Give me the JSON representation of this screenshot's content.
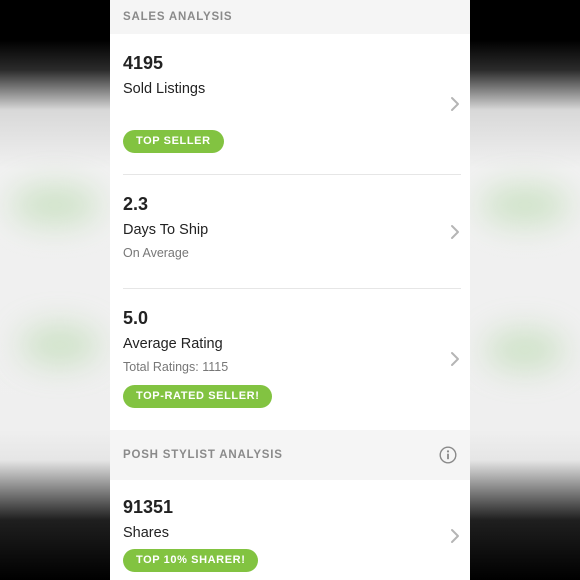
{
  "sales_section": {
    "title": "SALES ANALYSIS",
    "items": [
      {
        "value": "4195",
        "label": "Sold Listings",
        "sub": "",
        "badge": "TOP SELLER"
      },
      {
        "value": "2.3",
        "label": "Days To Ship",
        "sub": "On Average",
        "badge": ""
      },
      {
        "value": "5.0",
        "label": "Average Rating",
        "sub": "Total Ratings: 1115",
        "badge": "TOP-RATED SELLER!"
      }
    ]
  },
  "stylist_section": {
    "title": "POSH STYLIST ANALYSIS",
    "info_icon": "info-icon",
    "items": [
      {
        "value": "91351",
        "label": "Shares",
        "badge": "TOP 10% SHARER!"
      }
    ]
  },
  "colors": {
    "badge_green": "#82c341",
    "header_bg": "#f5f5f5",
    "header_text": "#8a8a8a"
  },
  "icons": {
    "chevron": "chevron-right-icon",
    "info": "info-icon"
  }
}
